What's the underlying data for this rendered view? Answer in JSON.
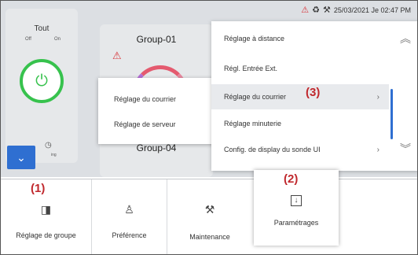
{
  "status": {
    "datetime": "25/03/2021 Je 02:47 PM",
    "icons": [
      "warning-icon",
      "eco-icon",
      "maintenance-icon"
    ]
  },
  "tout": {
    "title": "Tout",
    "off_label": "Off",
    "on_label": "On",
    "power_state": "on",
    "timer_label": "ing"
  },
  "groups": [
    {
      "name": "Group-01",
      "warning": true
    },
    {
      "name": "Group-04"
    }
  ],
  "submenu": {
    "items": [
      "Réglage du courrier",
      "Réglage de serveur"
    ]
  },
  "settings_menu": {
    "items": [
      {
        "label": "Réglage à distance",
        "chevron": false
      },
      {
        "label": "Régl. Entrée Ext.",
        "chevron": false
      },
      {
        "label": "Réglage du courrier",
        "chevron": true,
        "selected": true
      },
      {
        "label": "Réglage minuterie",
        "chevron": false
      },
      {
        "label": "Config. de display du sonde UI",
        "chevron": true
      }
    ],
    "scroll_up_icon": "double-chevron-up-icon",
    "scroll_down_icon": "double-chevron-down-icon"
  },
  "callouts": {
    "c1": "(1)",
    "c2": "(2)",
    "c3": "(3)"
  },
  "bottom_nav": {
    "items": [
      {
        "label": "Réglage de groupe",
        "icon": "group-settings-icon"
      },
      {
        "label": "Préférence",
        "icon": "user-icon"
      },
      {
        "label": "Maintenance",
        "icon": "maintenance-icon"
      },
      {
        "label": "Paramétrages",
        "icon": "download-settings-icon",
        "active": true
      }
    ]
  },
  "colors": {
    "accent_blue": "#2f6fd1",
    "power_green": "#37c24d",
    "warning_red": "#d8363b",
    "callout_red": "#c0282d"
  }
}
